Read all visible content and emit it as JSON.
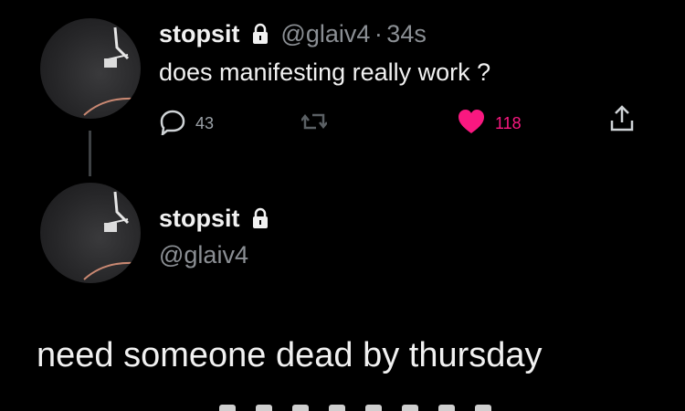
{
  "tweet": {
    "name": "stopsit",
    "handle": "@glaiv4",
    "separator": "·",
    "time": "34s",
    "text": "does manifesting really work ?",
    "replies": "43",
    "likes": "118",
    "icons": [
      "lock-icon",
      "reply-icon",
      "retweet-icon",
      "heart-icon",
      "share-icon"
    ]
  },
  "reply": {
    "name": "stopsit",
    "handle": "@glaiv4",
    "text": "need someone dead by thursday"
  },
  "colors": {
    "background": "#000000",
    "text": "#f1f1f1",
    "muted": "#8b8f94",
    "like": "#f91880"
  }
}
